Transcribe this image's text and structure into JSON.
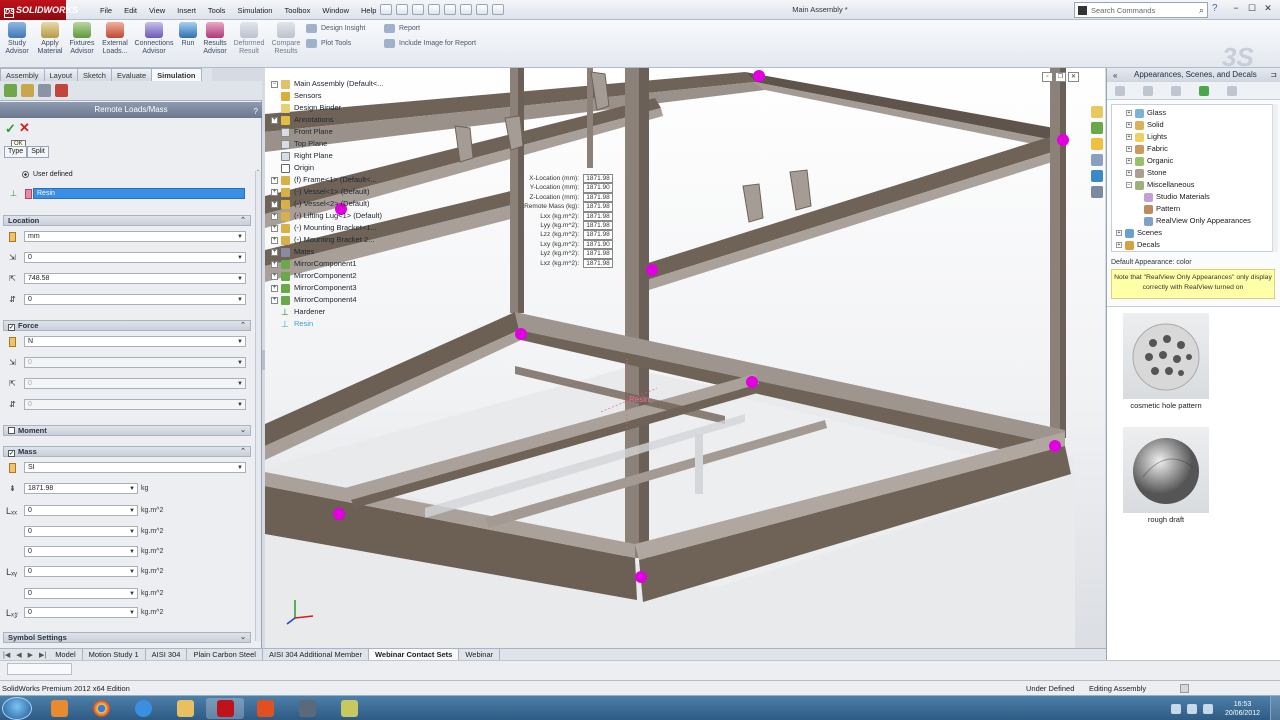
{
  "app": {
    "brand": "SOLIDWORKS",
    "document_title": "Main Assembly *",
    "menus": [
      "File",
      "Edit",
      "View",
      "Insert",
      "Tools",
      "Simulation",
      "Toolbox",
      "Window",
      "Help"
    ],
    "search_placeholder": "Search Commands",
    "help_glyph": "?",
    "window_controls": [
      "−",
      "☐",
      "✕"
    ]
  },
  "command_manager": {
    "buttons": [
      {
        "label": "Study\nAdvisor"
      },
      {
        "label": "Apply\nMaterial"
      },
      {
        "label": "Fixtures\nAdvisor"
      },
      {
        "label": "External\nLoads..."
      },
      {
        "label": "Connections\nAdvisor"
      },
      {
        "label": "Run"
      },
      {
        "label": "Results\nAdvisor"
      },
      {
        "label": "Deformed\nResult"
      },
      {
        "label": "Compare\nResults"
      }
    ],
    "small_buttons": [
      "Design Insight",
      "Plot Tools",
      "Report",
      "Include Image for Report"
    ],
    "tabs": [
      "Assembly",
      "Layout",
      "Sketch",
      "Evaluate",
      "Simulation"
    ],
    "active_tab": "Simulation"
  },
  "property_manager": {
    "title": "Remote Loads/Mass",
    "help": "?",
    "ok_tooltip": "OK",
    "type_tabs": [
      "Type",
      "Split"
    ],
    "user_defined_label": "User defined",
    "reference_field": "Resin",
    "sections": {
      "location": {
        "title": "Location",
        "unit": "mm",
        "x": "0",
        "y": "748.58",
        "z": "0"
      },
      "force": {
        "title": "Force",
        "unit": "N",
        "x": "0",
        "y": "0",
        "z": "0"
      },
      "moment": {
        "title": "Moment"
      },
      "mass": {
        "title": "Mass",
        "unit": "SI",
        "mass_value": "1871.98",
        "mass_unit": "kg",
        "inertia": [
          {
            "value": "0",
            "unit": "kg.m^2",
            "icon": "Lxx"
          },
          {
            "value": "0",
            "unit": "kg.m^2",
            "icon": ""
          },
          {
            "value": "0",
            "unit": "kg.m^2",
            "icon": ""
          },
          {
            "value": "0",
            "unit": "kg.m^2",
            "icon": "Lxy"
          },
          {
            "value": "0",
            "unit": "kg.m^2",
            "icon": ""
          },
          {
            "value": "0",
            "unit": "kg.m^2",
            "icon": "Lxz"
          }
        ]
      },
      "symbol_settings": {
        "title": "Symbol Settings"
      }
    }
  },
  "feature_tree": {
    "items": [
      {
        "label": "Main Assembly  (Default<...",
        "indent": 0,
        "icon": "assembly"
      },
      {
        "label": "Sensors",
        "indent": 1,
        "icon": "sensor"
      },
      {
        "label": "Design Binder",
        "indent": 1,
        "icon": "binder"
      },
      {
        "label": "Annotations",
        "indent": 1,
        "icon": "annotation"
      },
      {
        "label": "Front Plane",
        "indent": 1,
        "icon": "plane"
      },
      {
        "label": "Top Plane",
        "indent": 1,
        "icon": "plane"
      },
      {
        "label": "Right Plane",
        "indent": 1,
        "icon": "plane"
      },
      {
        "label": "Origin",
        "indent": 1,
        "icon": "origin"
      },
      {
        "label": "(f) Frame<1> (Default<...",
        "indent": 1,
        "icon": "part"
      },
      {
        "label": "(-) Vessel<1> (Default)",
        "indent": 1,
        "icon": "part"
      },
      {
        "label": "(-) Vessel<2> (Default)",
        "indent": 1,
        "icon": "part"
      },
      {
        "label": "(-) Lifting Lug<1> (Default)",
        "indent": 1,
        "icon": "part"
      },
      {
        "label": "(-) Mounting Bracket<1...",
        "indent": 1,
        "icon": "part"
      },
      {
        "label": "(-) Mounting Bracket 2...",
        "indent": 1,
        "icon": "part"
      },
      {
        "label": "Mates",
        "indent": 1,
        "icon": "mates"
      },
      {
        "label": "MirrorComponent1",
        "indent": 1,
        "icon": "mirror"
      },
      {
        "label": "MirrorComponent2",
        "indent": 1,
        "icon": "mirror"
      },
      {
        "label": "MirrorComponent3",
        "indent": 1,
        "icon": "mirror"
      },
      {
        "label": "MirrorComponent4",
        "indent": 1,
        "icon": "mirror"
      },
      {
        "label": "Hardener",
        "indent": 1,
        "icon": "point"
      },
      {
        "label": "Resin",
        "indent": 1,
        "icon": "point",
        "selected": true
      }
    ]
  },
  "mass_callout": [
    {
      "label": "X-Location (mm):",
      "value": "1871.98"
    },
    {
      "label": "Y-Location (mm):",
      "value": "1871.90"
    },
    {
      "label": "Z-Location (mm):",
      "value": "1871.98"
    },
    {
      "label": "Remote Mass (kg):",
      "value": "1871.98"
    },
    {
      "label": "Lxx (kg.m^2):",
      "value": "1871.98"
    },
    {
      "label": "Lyy (kg.m^2):",
      "value": "1871.98"
    },
    {
      "label": "Lzz (kg.m^2):",
      "value": "1871.98"
    },
    {
      "label": "Lxy (kg.m^2):",
      "value": "1871.90"
    },
    {
      "label": "Lyz (kg.m^2):",
      "value": "1871.98"
    },
    {
      "label": "Lxz (kg.m^2):",
      "value": "1871.98"
    }
  ],
  "viewport_label": "Resin",
  "task_pane": {
    "title": "Appearances, Scenes, and Decals",
    "tree": [
      {
        "label": "Glass",
        "indent": 1,
        "color": "#7bb3d8"
      },
      {
        "label": "Solid",
        "indent": 1,
        "color": "#d8b35a"
      },
      {
        "label": "Lights",
        "indent": 1,
        "color": "#f0d060"
      },
      {
        "label": "Fabric",
        "indent": 1,
        "color": "#c99a5a"
      },
      {
        "label": "Organic",
        "indent": 1,
        "color": "#9bc06a"
      },
      {
        "label": "Stone",
        "indent": 1,
        "color": "#a8a090"
      },
      {
        "label": "Miscellaneous",
        "indent": 1,
        "color": "#9fb07a"
      },
      {
        "label": "Studio Materials",
        "indent": 2,
        "color": "#c4a0d8"
      },
      {
        "label": "Pattern",
        "indent": 2,
        "color": "#c08a60"
      },
      {
        "label": "RealView Only Appearances",
        "indent": 2,
        "color": "#80a0c8"
      },
      {
        "label": "Scenes",
        "indent": 0,
        "color": "#6aa0d0"
      },
      {
        "label": "Decals",
        "indent": 0,
        "color": "#d8a040"
      }
    ],
    "default_appearance": "Default Appearance: color",
    "note": "Note that \"RealView Only Appearances\" only display correctly with RealView turned on",
    "swatches": [
      {
        "label": "cosmetic hole pattern"
      },
      {
        "label": "rough draft"
      }
    ]
  },
  "bottom_tabs": {
    "tabs": [
      "Model",
      "Motion Study 1",
      "AISI 304",
      "Plain Carbon Steel",
      "AISI 304 Additional Member",
      "Webinar Contact Sets",
      "Webinar"
    ],
    "active": "Webinar Contact Sets"
  },
  "status_bar": {
    "left": "SolidWorks Premium 2012 x64 Edition",
    "under_defined": "Under Defined",
    "mode": "Editing Assembly"
  },
  "taskbar": {
    "time": "16:53",
    "date": "20/06/2012"
  },
  "colors": {
    "accent_red": "#c0121a",
    "handle_magenta": "#e000e0",
    "steel": "#7a6e64",
    "selection_blue": "#39a0d8"
  }
}
